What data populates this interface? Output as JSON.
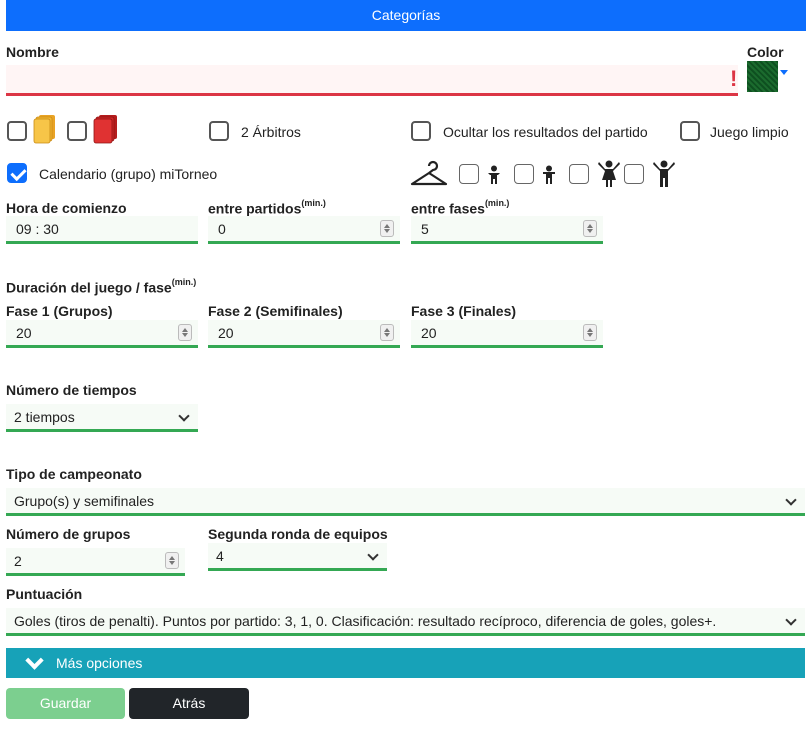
{
  "header": {
    "title": "Categorías"
  },
  "nombre": {
    "label": "Nombre",
    "value": "",
    "error_mark": "!"
  },
  "color": {
    "label": "Color",
    "value": "#1b6b2e"
  },
  "options": {
    "yellow_card": false,
    "red_card": false,
    "two_referees": {
      "label": "2 Árbitros",
      "checked": false
    },
    "hide_results": {
      "label": "Ocultar los resultados del partido",
      "checked": false
    },
    "fair_play": {
      "label": "Juego limpio",
      "checked": false
    },
    "calendar": {
      "label": "Calendario (grupo) miTorneo",
      "checked": true
    }
  },
  "times": {
    "start_label": "Hora de comienzo",
    "start_value": "09 : 30",
    "between_matches_label": "entre partidos",
    "between_matches_value": "0",
    "between_phases_label": "entre fases",
    "between_phases_value": "5",
    "unit": "(min.)"
  },
  "duration": {
    "label": "Duración del juego / fase",
    "unit": "(min.)",
    "phase1_label": "Fase 1 (Grupos)",
    "phase1_value": "20",
    "phase2_label": "Fase 2 (Semifinales)",
    "phase2_value": "20",
    "phase3_label": "Fase 3 (Finales)",
    "phase3_value": "20"
  },
  "periods": {
    "label": "Número de tiempos",
    "value": "2 tiempos"
  },
  "championship": {
    "label": "Tipo de campeonato",
    "value": "Grupo(s) y semifinales"
  },
  "groups": {
    "label": "Número de grupos",
    "value": "2"
  },
  "second_round": {
    "label": "Segunda ronda de equipos",
    "value": "4"
  },
  "scoring": {
    "label": "Puntuación",
    "value": "Goles (tiros de penalti). Puntos por partido: 3, 1, 0. Clasificación: resultado recíproco, diferencia de goles, goles+."
  },
  "more": {
    "label": "Más opciones"
  },
  "buttons": {
    "save": "Guardar",
    "back": "Atrás"
  },
  "colors": {
    "primary": "#0d6efd",
    "success": "#34a853",
    "danger": "#dc3545",
    "info": "#17a2b8",
    "dark": "#212529"
  }
}
